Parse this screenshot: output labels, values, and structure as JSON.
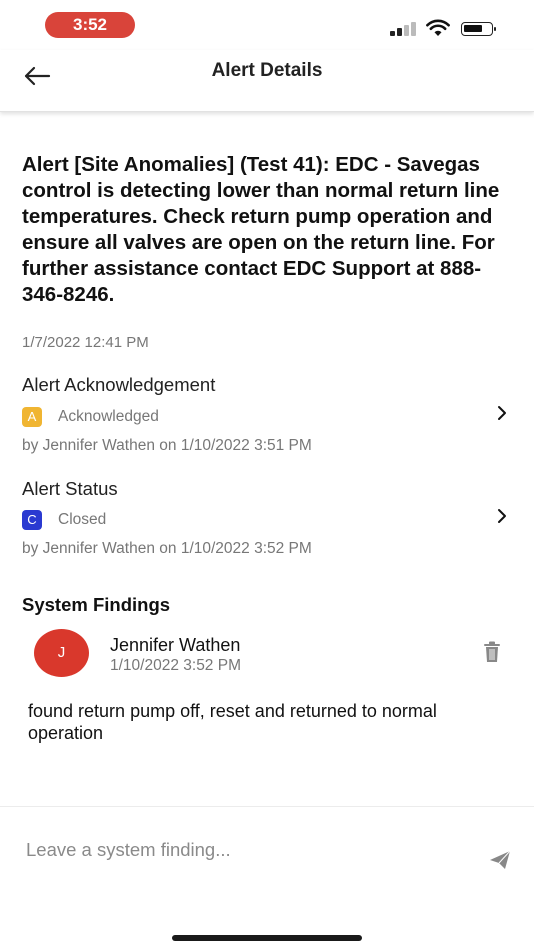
{
  "status_bar": {
    "time": "3:52"
  },
  "header": {
    "title": "Alert Details"
  },
  "alert": {
    "message": "Alert [Site Anomalies] (Test 41): EDC - Savegas control is detecting lower than normal return line temperatures. Check return pump operation and ensure all valves are open on the return line. For further assistance contact EDC Support at 888-346-8246.",
    "date": "1/7/2022 12:41 PM"
  },
  "acknowledgement": {
    "title": "Alert Acknowledgement",
    "badge": "A",
    "badge_color": "#f0b532",
    "status": "Acknowledged",
    "by": "by Jennifer Wathen on 1/10/2022 3:51 PM"
  },
  "alert_status": {
    "title": "Alert Status",
    "badge": "C",
    "badge_color": "#2a3ad1",
    "status": "Closed",
    "by": "by Jennifer Wathen on 1/10/2022 3:52 PM"
  },
  "findings": {
    "title": "System Findings",
    "items": [
      {
        "avatar": "J",
        "author": "Jennifer Wathen",
        "date": "1/10/2022 3:52 PM",
        "text": "found return pump off, reset and returned to normal operation"
      }
    ]
  },
  "input": {
    "placeholder": "Leave a system finding..."
  },
  "icons": {
    "back": "back-arrow-icon",
    "chevron": "chevron-right-icon",
    "trash": "trash-icon",
    "send": "send-icon"
  }
}
